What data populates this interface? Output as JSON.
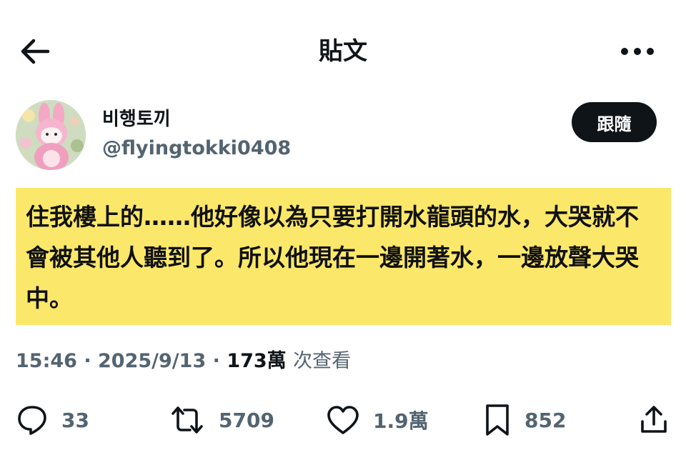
{
  "header": {
    "title": "貼文",
    "back_icon": "arrow-left-icon",
    "more_icon": "more-horizontal-icon"
  },
  "author": {
    "display_name": "비행토끼",
    "handle": "@flyingtokki0408",
    "follow_label": "跟隨"
  },
  "tweet": {
    "text": "住我樓上的……他好像以為只要打開水龍頭的水，大哭就不會被其他人聽到了。所以他現在一邊開著水，一邊放聲大哭中。",
    "highlight_color": "#fbe86a"
  },
  "meta": {
    "time": "15:46",
    "separator": " · ",
    "date": "2025/9/13",
    "views_count": "173萬",
    "views_label": "次查看"
  },
  "actions": {
    "replies": "33",
    "retweets": "5709",
    "likes": "1.9萬",
    "bookmarks": "852"
  },
  "colors": {
    "text_primary": "#0f1419",
    "text_secondary": "#536471",
    "follow_bg": "#0f1419"
  }
}
